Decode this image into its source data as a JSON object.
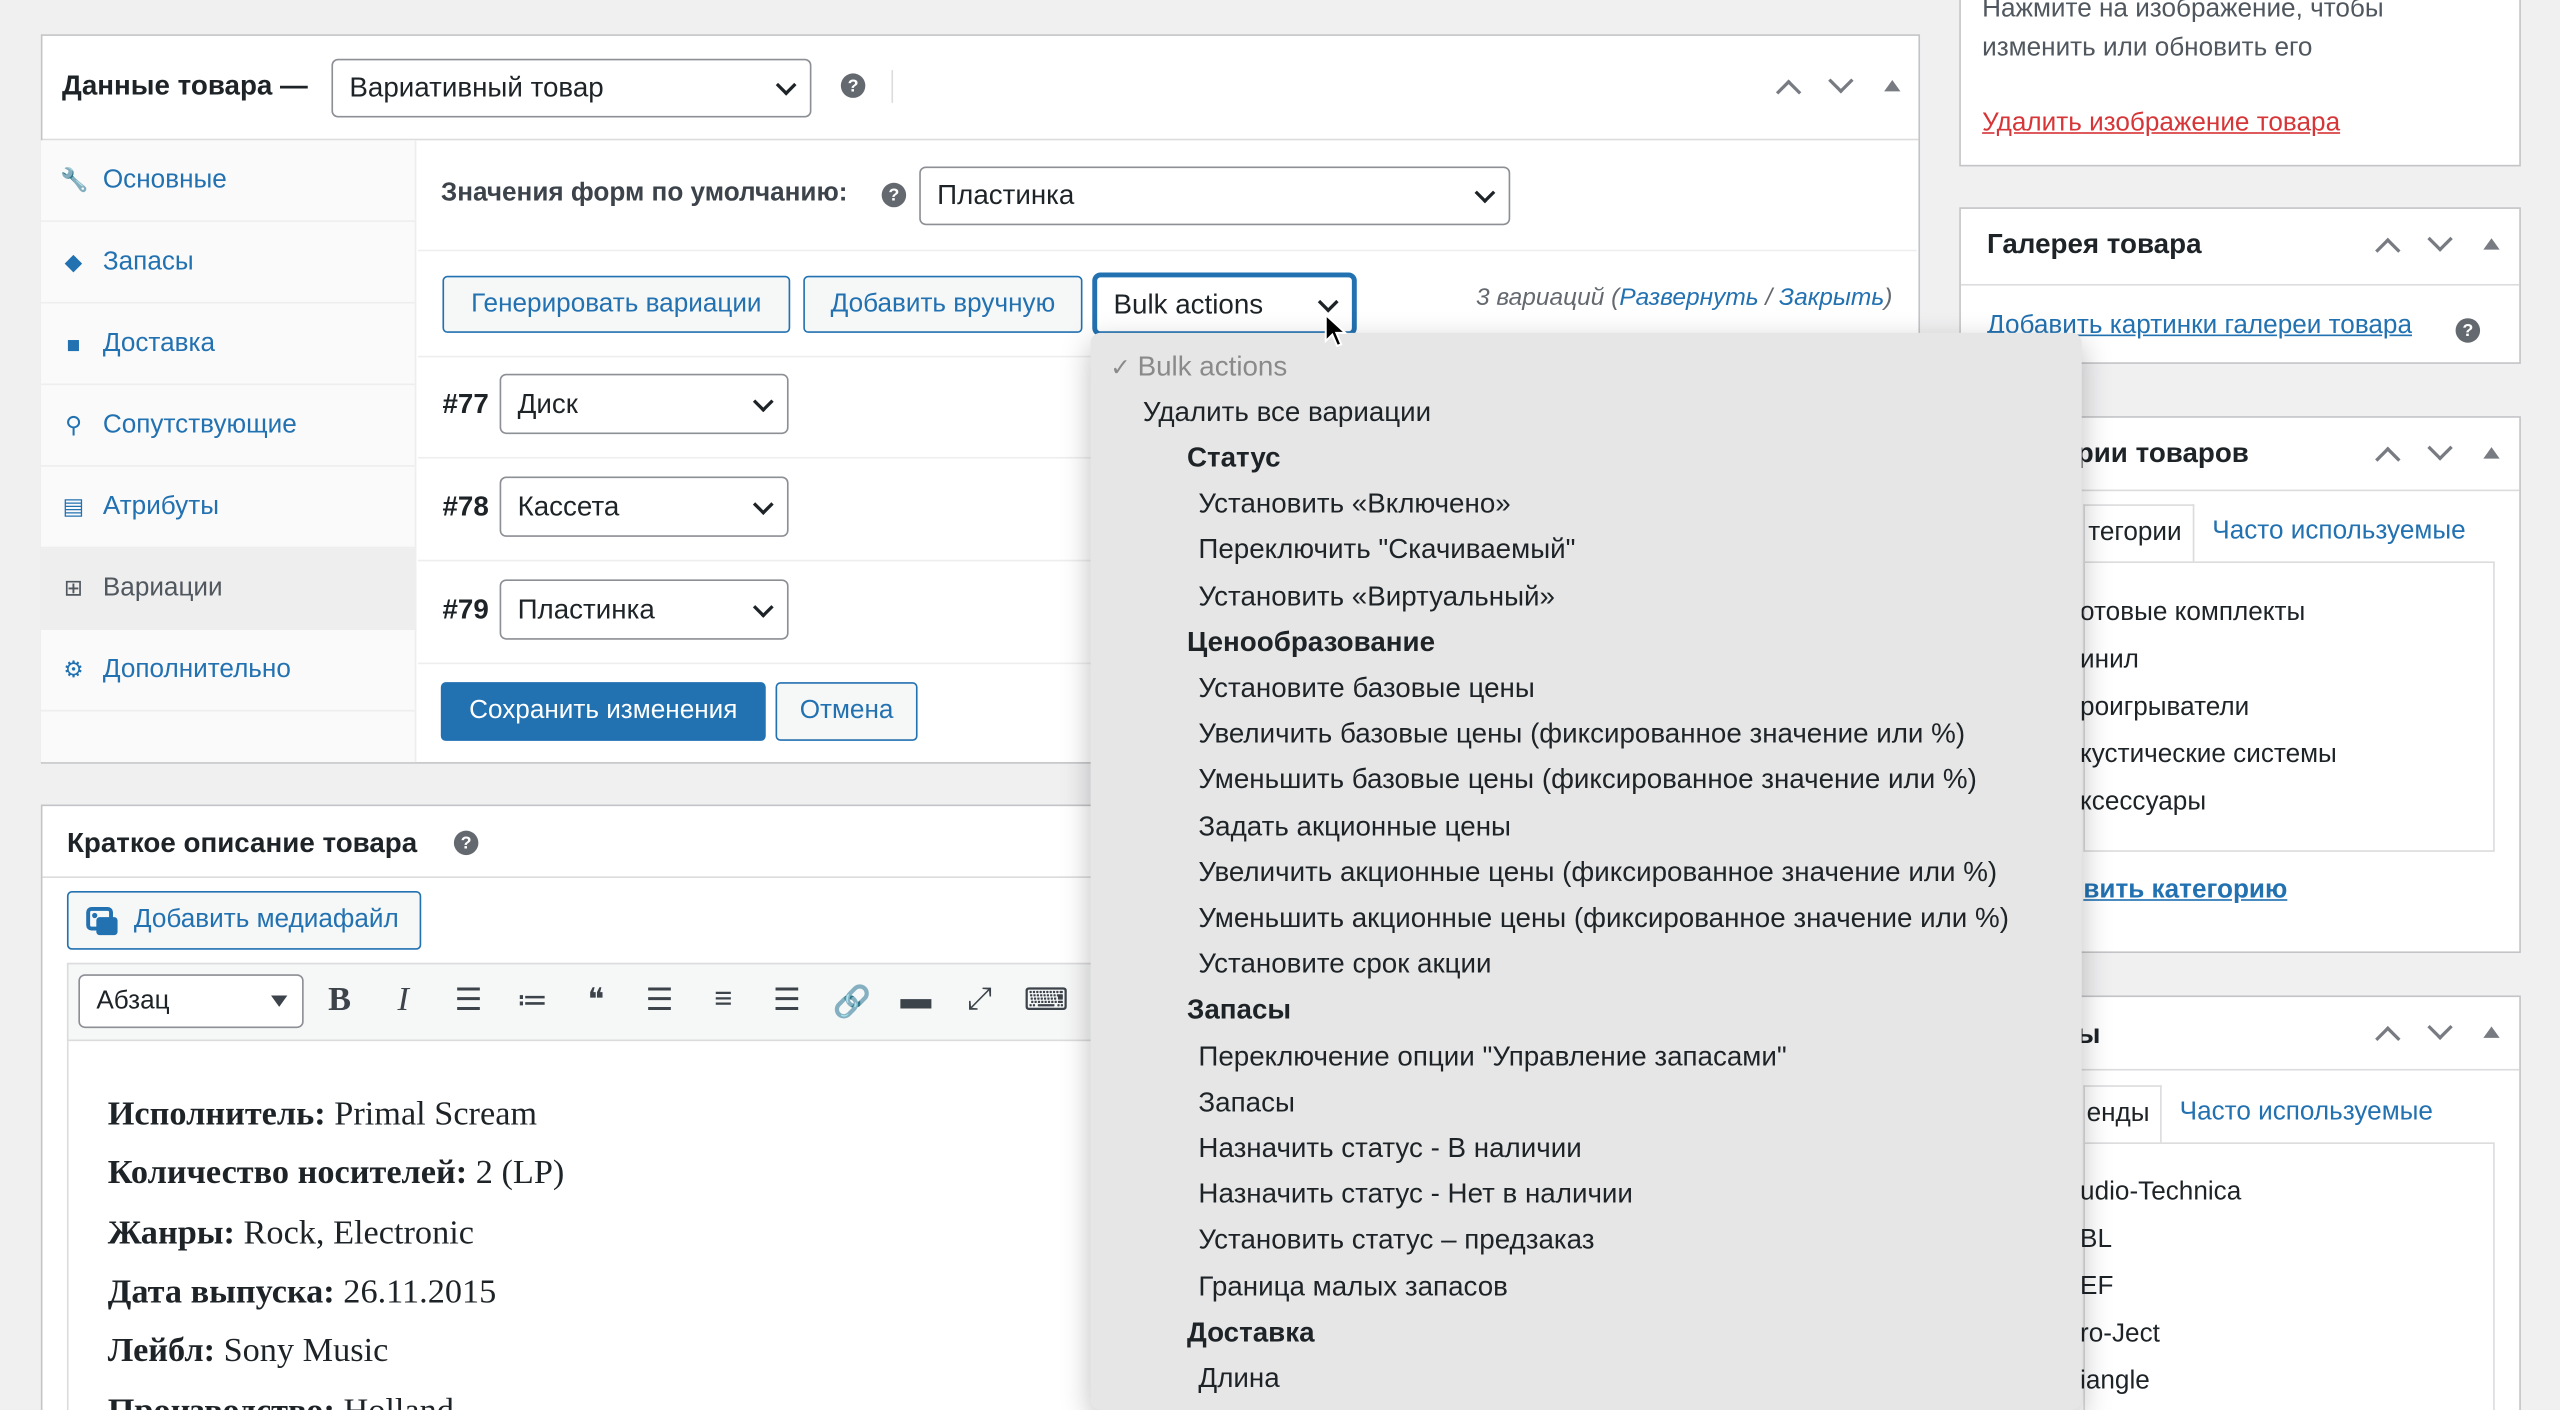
{
  "product_data": {
    "title": "Данные товара —",
    "type_value": "Вариативный товар",
    "tabs": [
      {
        "icon": "wrench-icon",
        "label": "Основные"
      },
      {
        "icon": "tag-icon",
        "label": "Запасы"
      },
      {
        "icon": "truck-icon",
        "label": "Доставка"
      },
      {
        "icon": "link-icon",
        "label": "Сопутствующие"
      },
      {
        "icon": "list-icon",
        "label": "Атрибуты"
      },
      {
        "icon": "grid-icon",
        "label": "Вариации"
      },
      {
        "icon": "gear-icon",
        "label": "Дополнительно"
      }
    ],
    "default_label": "Значения форм по умолчанию:",
    "default_value": "Пластинка",
    "btn_generate": "Генерировать вариации",
    "btn_add": "Добавить вручную",
    "bulk_value": "Bulk actions",
    "count_text": "3 вариаций (",
    "expand": "Развернуть",
    "slash": " / ",
    "close": "Закрыть",
    "paren": ")",
    "variations": [
      {
        "num": "#77",
        "value": "Диск"
      },
      {
        "num": "#78",
        "value": "Кассета"
      },
      {
        "num": "#79",
        "value": "Пластинка"
      }
    ],
    "save": "Сохранить изменения",
    "cancel": "Отмена"
  },
  "short_desc": {
    "title": "Краткое описание товара",
    "media_btn": "Добавить медиафайл",
    "format_value": "Абзац",
    "toolbar_icons": [
      "bold-icon",
      "italic-icon",
      "bullet-list-icon",
      "numbered-list-icon",
      "blockquote-icon",
      "align-left-icon",
      "align-center-icon",
      "align-right-icon",
      "link-icon",
      "read-more-icon",
      "fullscreen-icon",
      "toolbar-toggle-icon"
    ],
    "lines": [
      {
        "label": "Исполнитель:",
        "value": " Primal Scream"
      },
      {
        "label": "Количество носителей:",
        "value": " 2 (LP)"
      },
      {
        "label": "Жанры:",
        "value": " Rock, Electronic"
      },
      {
        "label": "Дата выпуска:",
        "value": " 26.11.2015"
      },
      {
        "label": "Лейбл:",
        "value": " Sony Music"
      },
      {
        "label": "Производство:",
        "value": " Holland"
      }
    ]
  },
  "product_image": {
    "hint_line1": "Нажмите на изображение, чтобы",
    "hint_line2": "изменить или обновить его",
    "remove": "Удалить изображение товара"
  },
  "gallery": {
    "title": "Галерея товара",
    "add": "Добавить картинки галереи товара"
  },
  "categories": {
    "title": "рии товаров",
    "tab_all": "тегории",
    "tab_popular": "Часто используемые",
    "items": [
      "отовые комплекты",
      "инил",
      "роигрыватели",
      "кустические системы",
      "ксессуары"
    ],
    "add": "вить категорию"
  },
  "brands": {
    "title": "ы",
    "tab_all": "енды",
    "tab_popular": "Часто используемые",
    "items": [
      "udio-Technica",
      "BL",
      "EF",
      "ro-Ject",
      "iangle"
    ]
  },
  "bulk_menu": {
    "selected": "Bulk actions",
    "delete_all": "Удалить все вариации",
    "groups": [
      {
        "label": "Статус",
        "items": [
          "Установить «Включено»",
          "Переключить \"Скачиваемый\"",
          "Установить «Виртуальный»"
        ]
      },
      {
        "label": "Ценообразование",
        "items": [
          "Установите базовые цены",
          "Увеличить базовые цены (фиксированное значение или %)",
          "Уменьшить базовые цены (фиксированное значение или %)",
          "Задать акционные цены",
          "Увеличить акционные цены (фиксированное значение или %)",
          "Уменьшить акционные цены (фиксированное значение или %)",
          "Установите срок акции"
        ]
      },
      {
        "label": "Запасы",
        "items": [
          "Переключение опции \"Управление запасами\"",
          "Запасы",
          "Назначить статус - В наличии",
          "Назначить статус - Нет в наличии",
          "Установить статус – предзаказ",
          "Граница малых запасов"
        ]
      },
      {
        "label": "Доставка",
        "items": [
          "Длина"
        ]
      }
    ]
  },
  "colors": {
    "accent": "#2271b1",
    "danger": "#d63638",
    "menu_bg": "#e6e6e6"
  }
}
